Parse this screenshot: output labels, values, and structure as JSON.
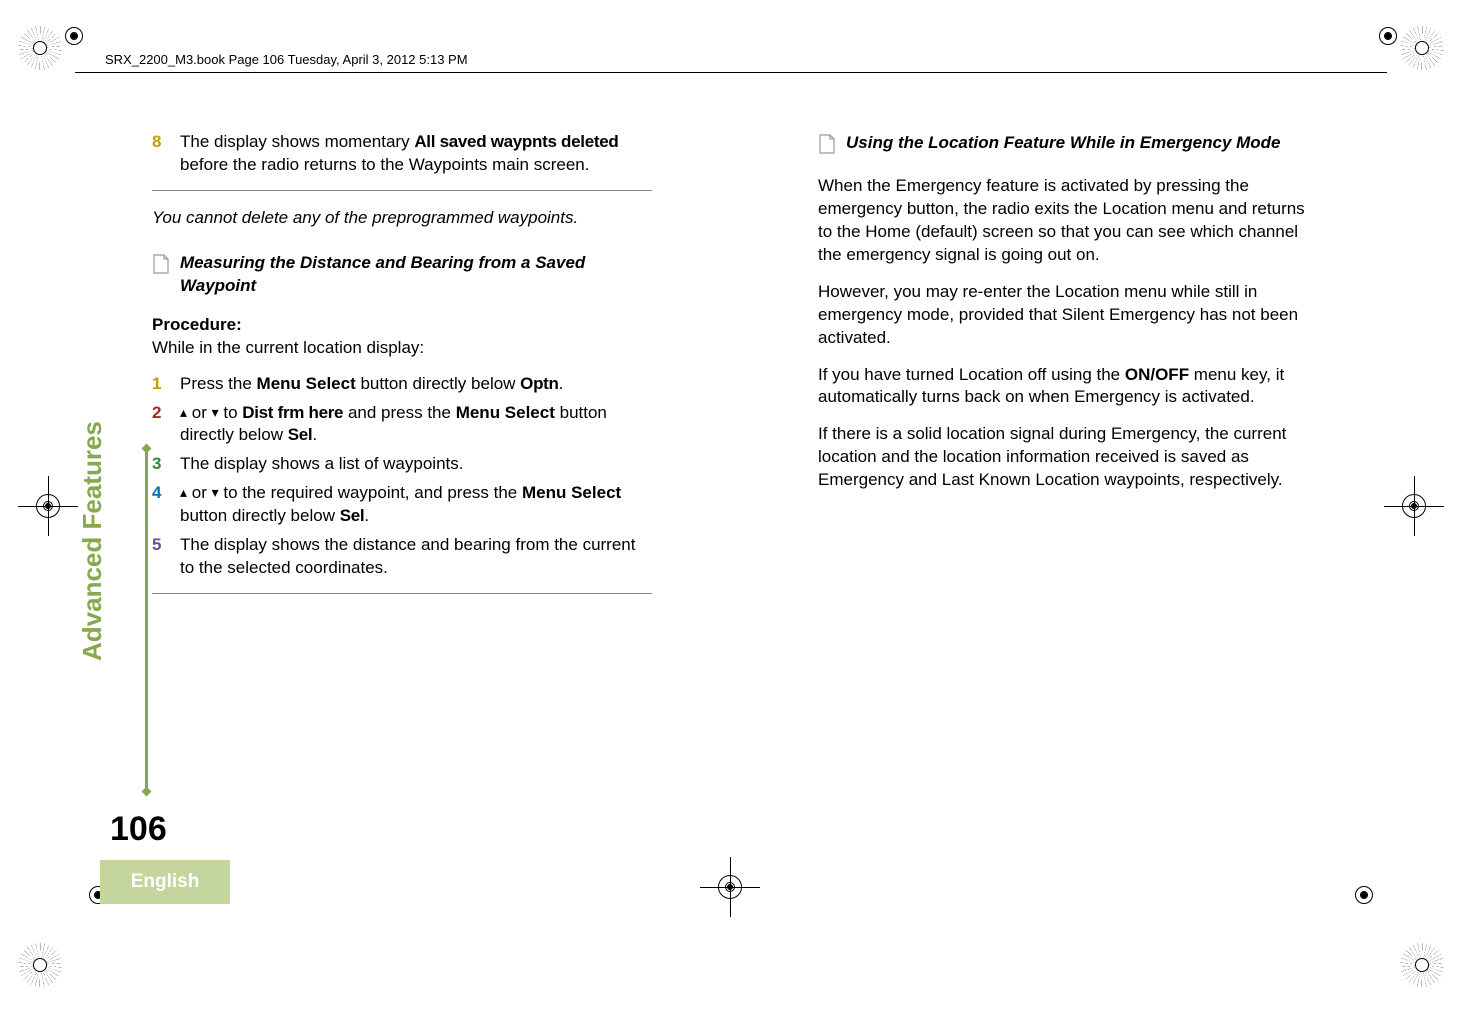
{
  "meta": {
    "header_line": "SRX_2200_M3.book  Page 106  Tuesday, April 3, 2012  5:13 PM"
  },
  "left_col": {
    "step8_prefix": "The display shows momentary ",
    "step8_mono": "All saved waypnts deleted",
    "step8_suffix": " before the radio returns to the Waypoints main screen.",
    "note": "You cannot delete any of the preprogrammed waypoints.",
    "heading": "Measuring the Distance and Bearing from a Saved Waypoint",
    "procedure_label": "Procedure:",
    "procedure_sub": "While in the current location display:",
    "step1_prefix": "Press the ",
    "step1_bold": "Menu Select",
    "step1_mid": " button directly below ",
    "step1_mono": "Optn",
    "step1_suffix": ".",
    "step2_or": " or ",
    "step2_to": " to ",
    "step2_mono": "Dist frm here",
    "step2_mid": " and press the ",
    "step2_bold": "Menu Select",
    "step2_suffix": " button directly below ",
    "step2_mono2": "Sel",
    "step2_end": ".",
    "step3": "The display shows a list of waypoints.",
    "step4_or": " or ",
    "step4_mid": " to the required waypoint, and press the ",
    "step4_bold": "Menu Select",
    "step4_suffix": " button directly below ",
    "step4_mono": "Sel",
    "step4_end": ".",
    "step5": "The display shows the distance and bearing from the current to the selected coordinates."
  },
  "right_col": {
    "heading": "Using the Location Feature While in Emergency Mode",
    "p1": "When the Emergency feature is activated by pressing the emergency button, the radio exits the Location menu and returns to the Home (default) screen so that you can see which channel the emergency signal is going out on.",
    "p2": "However, you may re-enter the Location menu while still in emergency mode, provided that Silent Emergency has not been activated.",
    "p3a": "If you have turned Location off using the ",
    "p3_bold": "ON/OFF",
    "p3b": " menu key, it automatically turns back on when Emergency is activated.",
    "p4": "If there is a solid location signal during Emergency, the current location and the location information received is saved as Emergency and Last Known Location waypoints, respectively."
  },
  "spine": {
    "section": "Advanced Features",
    "page_number": "106",
    "language": "English"
  }
}
